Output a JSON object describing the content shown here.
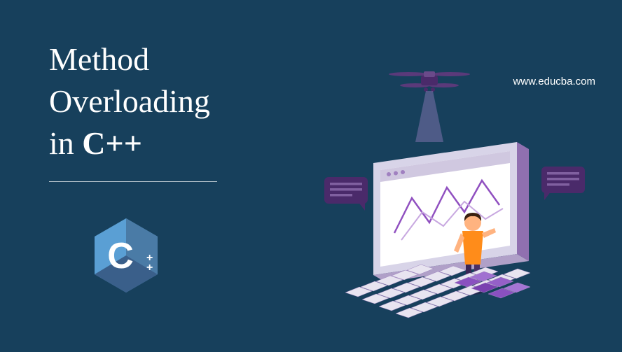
{
  "title": {
    "line1": "Method",
    "line2": "Overloading",
    "line3_prefix": "in ",
    "line3_bold": "C++"
  },
  "logo": {
    "letter": "C",
    "suffix": "++"
  },
  "website_url": "www.educba.com"
}
